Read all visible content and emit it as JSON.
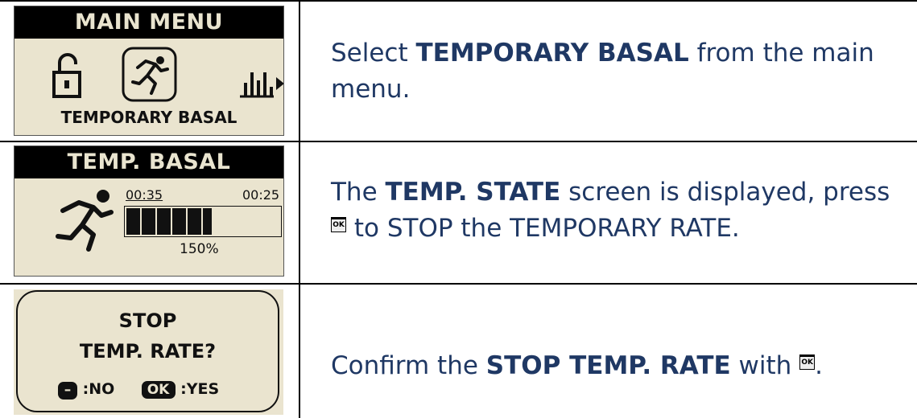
{
  "rows": [
    {
      "screen": {
        "title": "MAIN MENU",
        "footer": "TEMPORARY BASAL"
      },
      "instruction": {
        "pre": "Select ",
        "bold": "TEMPORARY BASAL",
        "post": " from the main menu."
      }
    },
    {
      "screen": {
        "title": "TEMP. BASAL",
        "time_left": "00:35",
        "time_right": "00:25",
        "percent": "150%",
        "progress": 0.55
      },
      "instruction": {
        "pre": "The ",
        "bold": "TEMP. STATE",
        "mid": " screen is displayed, press ",
        "ok": "OK",
        "post": " to STOP the TEMPORARY RATE."
      }
    },
    {
      "screen": {
        "line1": "STOP",
        "line2": "TEMP. RATE?",
        "no_key": "–",
        "no_label": ":NO",
        "yes_key": "OK",
        "yes_label": ":YES"
      },
      "instruction": {
        "pre": "Confirm the ",
        "bold": "STOP TEMP. RATE",
        "mid": " with ",
        "ok": "OK",
        "post": "."
      }
    }
  ]
}
